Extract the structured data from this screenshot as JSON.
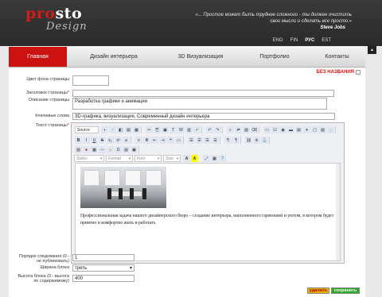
{
  "header": {
    "logo_red": "pro",
    "logo_white": "sto",
    "logo_sub": "Design",
    "quote": "«... Простое может быть труднее сложного - ты должен очистить свои мысли и сделать все просто.»",
    "quote_author": "Steve Jobs",
    "languages": [
      "ENG",
      "FIN",
      "РУС",
      "EST"
    ],
    "active_language": "РУС"
  },
  "nav": {
    "items": [
      "Главная",
      "Дизайн интерьера",
      "3D Визуализация",
      "Портфолио",
      "Контакты"
    ],
    "active": "Главная"
  },
  "side_button": "▲",
  "panel": {
    "noname": "БЕЗ НАЗВАНИЯ",
    "bg_color_label": "Цвет фона страницы",
    "title_label": "Заголовок страницы",
    "title_value": "",
    "description_label": "Описание страницы",
    "description_value": "Разработка графики и анимации",
    "keywords_label": "Ключевые слова",
    "keywords_value": "3D-графика, визуализация, Современный дизайн интерьера",
    "text_label": "Текст страницы",
    "order_label": "Порядок следования (0 - не публиковать)",
    "order_value": "1",
    "block_width_label": "Ширина блока",
    "block_width_value": "треть",
    "block_height_label": "Высота блока (0 - высота по содержимому)",
    "block_height_value": "400",
    "delete_label": "удалить",
    "save_label": "сохранить"
  },
  "editor": {
    "source_label": "Source",
    "styles_placeholder": "Styles",
    "format_placeholder": "Format",
    "font_placeholder": "Font",
    "size_placeholder": "Size",
    "body_text": "Профессиональная задача нашего дизайнерского бюро – создание интерьера, наполненного гармонией и уютом, в котором будет приятно и комфортно жить и работать"
  },
  "colors": {
    "accent": "#cc1111",
    "save": "#27a827",
    "delete": "#e6b200"
  }
}
